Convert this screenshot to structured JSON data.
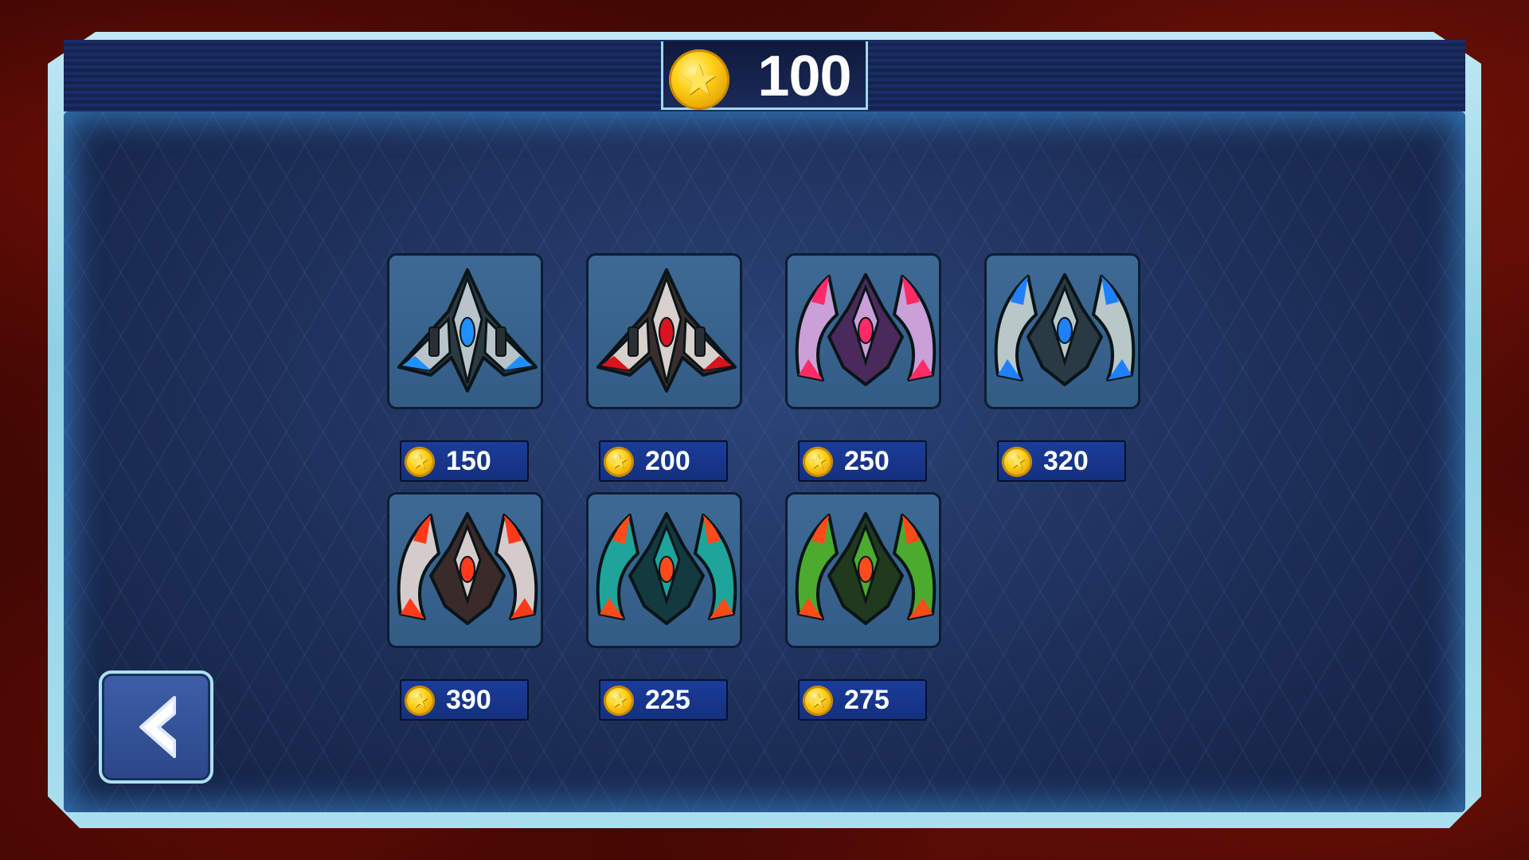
{
  "header": {
    "coin_balance": "100",
    "coin_icon": "gold-star-coin-icon"
  },
  "ships": [
    {
      "price": "150",
      "colors": {
        "main": "#b8c4c8",
        "accent": "#1e8fff",
        "dark": "#2b3a40"
      }
    },
    {
      "price": "200",
      "colors": {
        "main": "#d8d0cc",
        "accent": "#d8141e",
        "dark": "#3a2f2f"
      }
    },
    {
      "price": "250",
      "colors": {
        "main": "#c9a0d8",
        "accent": "#ff2a66",
        "dark": "#4a2a5a"
      }
    },
    {
      "price": "320",
      "colors": {
        "main": "#b8c8c8",
        "accent": "#1e7fff",
        "dark": "#2a3a44"
      }
    },
    {
      "price": "390",
      "colors": {
        "main": "#d4cccc",
        "accent": "#ff3a1a",
        "dark": "#3a2a2a"
      }
    },
    {
      "price": "225",
      "colors": {
        "main": "#1ea49a",
        "accent": "#ff4a1a",
        "dark": "#133a3e"
      }
    },
    {
      "price": "275",
      "colors": {
        "main": "#4caa2e",
        "accent": "#ff4a1a",
        "dark": "#1f3a1c"
      }
    }
  ],
  "back_button": {
    "icon": "chevron-left-icon"
  }
}
